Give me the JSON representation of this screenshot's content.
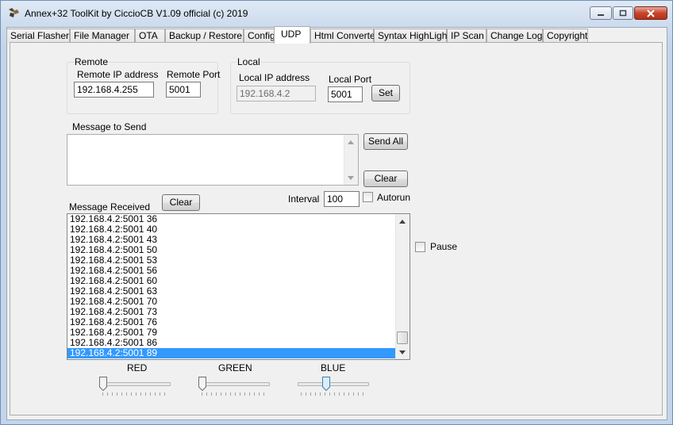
{
  "window": {
    "title": "Annex+32 ToolKit by CiccioCB V1.09 official (c) 2019"
  },
  "tabs": [
    {
      "label": "Serial Flasher"
    },
    {
      "label": "File Manager"
    },
    {
      "label": "OTA"
    },
    {
      "label": "Backup / Restore"
    },
    {
      "label": "Config"
    },
    {
      "label": "UDP"
    },
    {
      "label": "Html Converter"
    },
    {
      "label": "Syntax HighLight"
    },
    {
      "label": "IP Scan"
    },
    {
      "label": "Change Log"
    },
    {
      "label": "Copyright"
    }
  ],
  "active_tab": "UDP",
  "remote": {
    "group_label": "Remote",
    "ip_label": "Remote IP address",
    "ip_value": "192.168.4.255",
    "port_label": "Remote Port",
    "port_value": "5001"
  },
  "local": {
    "group_label": "Local",
    "ip_label": "Local IP address",
    "ip_value": "192.168.4.2",
    "port_label": "Local Port",
    "port_value": "5001",
    "set_label": "Set"
  },
  "send": {
    "label": "Message to Send",
    "message": "",
    "send_all_label": "Send All",
    "clear_label": "Clear"
  },
  "interval": {
    "label": "Interval",
    "value": "100",
    "autorun_label": "Autorun"
  },
  "received": {
    "label": "Message Received",
    "clear_label": "Clear",
    "pause_label": "Pause",
    "rows": [
      "192.168.4.2:5001 36",
      "192.168.4.2:5001 40",
      "192.168.4.2:5001 43",
      "192.168.4.2:5001 50",
      "192.168.4.2:5001 53",
      "192.168.4.2:5001 56",
      "192.168.4.2:5001 60",
      "192.168.4.2:5001 63",
      "192.168.4.2:5001 70",
      "192.168.4.2:5001 73",
      "192.168.4.2:5001 76",
      "192.168.4.2:5001 79",
      "192.168.4.2:5001 86",
      "192.168.4.2:5001 89"
    ],
    "selected_index": 13
  },
  "sliders": {
    "red_label": "RED",
    "green_label": "GREEN",
    "blue_label": "BLUE",
    "red_level": 0,
    "green_level": 0,
    "blue_level": 0.4
  },
  "colors": {
    "selection": "#3399ff",
    "close_button": "#c7452c"
  }
}
